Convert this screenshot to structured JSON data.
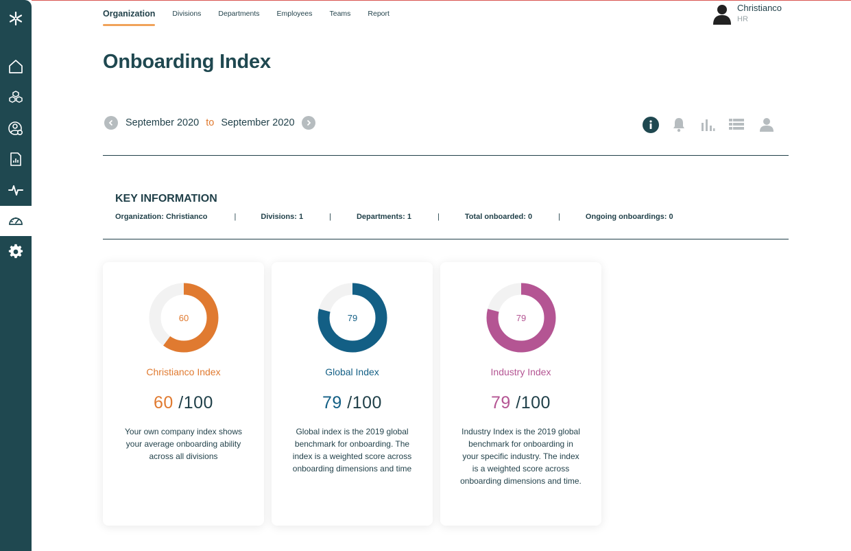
{
  "nav": {
    "tabs": [
      {
        "label": "Organization",
        "active": true
      },
      {
        "label": "Divisions"
      },
      {
        "label": "Departments"
      },
      {
        "label": "Employees"
      },
      {
        "label": "Teams"
      },
      {
        "label": "Report"
      }
    ]
  },
  "user": {
    "name": "Christianco",
    "role": "HR"
  },
  "page": {
    "title": "Onboarding Index"
  },
  "daterange": {
    "from": "September 2020",
    "to_label": "to",
    "to": "September 2020"
  },
  "toolbar": {
    "icons": [
      "info-icon",
      "bell-icon",
      "bar-chart-icon",
      "list-icon",
      "person-icon"
    ]
  },
  "key_info": {
    "title": "KEY INFORMATION",
    "separator": "|",
    "items": [
      "Organization: Christianco",
      "Divisions: 1",
      "Departments: 1",
      "Total onboarded: 0",
      "Ongoing onboardings: 0"
    ]
  },
  "cards": [
    {
      "value": "60",
      "max": "/100",
      "color": "#e07a30",
      "title": "Christianco Index",
      "desc": "Your own company index shows your average onboarding ability across all divisions"
    },
    {
      "value": "79",
      "max": "/100",
      "color": "#135f85",
      "title": "Global Index",
      "desc": "Global index is the 2019 global benchmark for onboarding. The index is a weighted score across onboarding dimensions and time"
    },
    {
      "value": "79",
      "max": "/100",
      "color": "#b45593",
      "title": "Industry Index",
      "desc": "Industry Index is the 2019 global benchmark for onboarding in your specific industry. The index is a weighted score across onboarding dimensions and time."
    }
  ],
  "colors": {
    "sidebar": "#1f4850",
    "accent": "#f0a25a",
    "track": "#f2f2f2"
  }
}
